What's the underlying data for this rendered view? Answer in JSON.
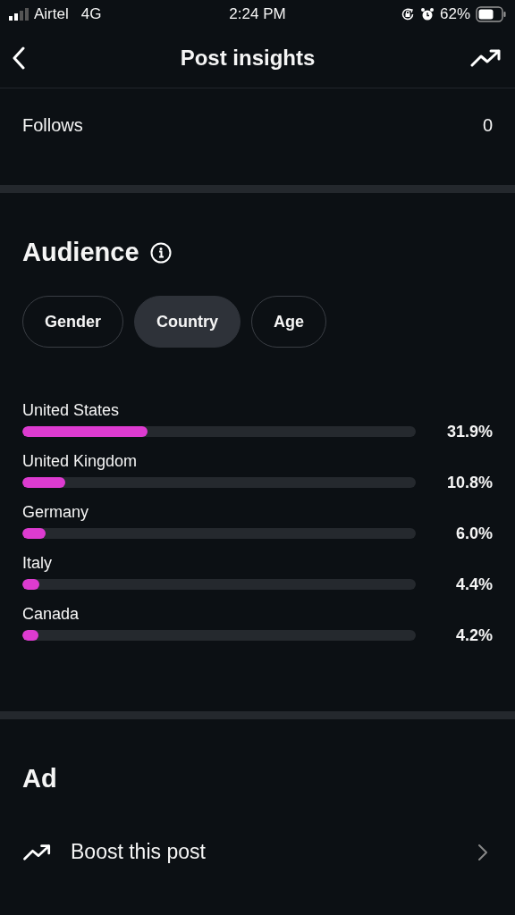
{
  "status_bar": {
    "carrier": "Airtel",
    "network": "4G",
    "time": "2:24 PM",
    "battery": "62%"
  },
  "header": {
    "title": "Post insights"
  },
  "follows": {
    "label": "Follows",
    "value": "0"
  },
  "audience": {
    "title": "Audience",
    "tabs": [
      {
        "label": "Gender",
        "selected": false
      },
      {
        "label": "Country",
        "selected": true
      },
      {
        "label": "Age",
        "selected": false
      }
    ],
    "rows": [
      {
        "name": "United States",
        "level": 0.319,
        "reading": "31.9%"
      },
      {
        "name": "United Kingdom",
        "level": 0.108,
        "reading": "10.8%"
      },
      {
        "name": "Germany",
        "level": 0.06,
        "reading": "6.0%"
      },
      {
        "name": "Italy",
        "level": 0.044,
        "reading": "4.4%"
      },
      {
        "name": "Canada",
        "level": 0.042,
        "reading": "4.2%"
      }
    ]
  },
  "ad": {
    "title": "Ad",
    "action": "Boost this post"
  }
}
